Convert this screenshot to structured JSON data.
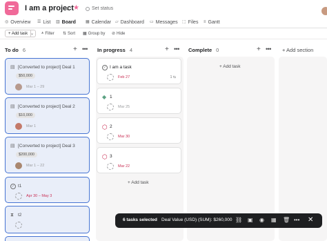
{
  "project": {
    "title": "I am a project",
    "set_status": "Set status"
  },
  "tabs": [
    {
      "label": "Overview",
      "icon": "circle-icon"
    },
    {
      "label": "List",
      "icon": "list-icon"
    },
    {
      "label": "Board",
      "icon": "board-icon",
      "active": true
    },
    {
      "label": "Calendar",
      "icon": "calendar-icon"
    },
    {
      "label": "Dashboard",
      "icon": "dashboard-icon"
    },
    {
      "label": "Messages",
      "icon": "messages-icon"
    },
    {
      "label": "Files",
      "icon": "files-icon"
    },
    {
      "label": "Gantt",
      "icon": "gantt-icon"
    }
  ],
  "toolbar": {
    "add_task": "+ Add task",
    "filter": "Filter",
    "sort": "Sort",
    "group_by": "Group by",
    "hide": "Hide"
  },
  "columns": [
    {
      "name": "To do",
      "count": "6"
    },
    {
      "name": "In progress",
      "count": "4"
    },
    {
      "name": "Complete",
      "count": "0"
    }
  ],
  "add_section": "+ Add section",
  "todo_cards": [
    {
      "title": "[Converted to project] Deal 1",
      "tag": "$50,000",
      "date": "Mar 1 – 29",
      "date_color": "gray"
    },
    {
      "title": "[Converted to project] Deal 2",
      "tag": "$10,000",
      "date": "Mar 1",
      "date_color": "gray"
    },
    {
      "title": "[Converted to project] Deal 3",
      "tag": "$200,000",
      "date": "Mar 1 – 22",
      "date_color": "gray"
    },
    {
      "title": "t1",
      "date": "Apr 30 – May 3",
      "date_color": "red"
    },
    {
      "title": "t2"
    }
  ],
  "progress_cards": [
    {
      "title": "I am a task",
      "date": "Feb 27",
      "meta": "1 ⇆",
      "date_color": "red"
    },
    {
      "title": "1",
      "date": "Mar 25",
      "date_color": "gray"
    },
    {
      "title": "2",
      "date": "Mar 30",
      "date_color": "red"
    },
    {
      "title": "3",
      "date": "Mar 22",
      "date_color": "red"
    }
  ],
  "add_task_link": "+ Add task",
  "selection_bar": {
    "count": "6 tasks selected",
    "sum": "Deal Value (USD) (SUM): $260,000"
  },
  "colors": {
    "brand_pink": "#f06a99",
    "selected_border": "#4573d2",
    "selected_bg": "#e9eef9",
    "overdue_red": "#c92f54"
  }
}
